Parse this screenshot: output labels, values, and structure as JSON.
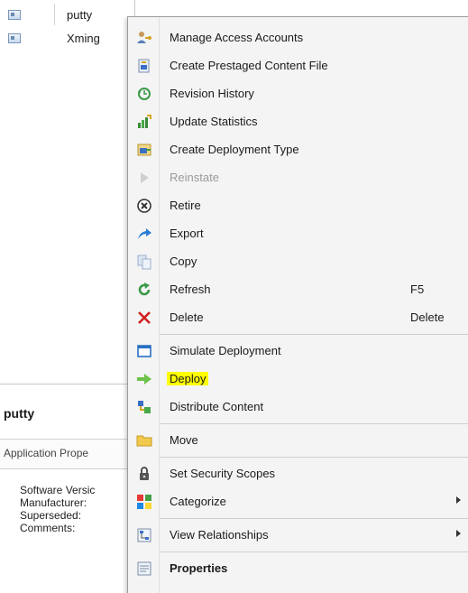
{
  "list": {
    "rows": [
      {
        "name": "putty"
      },
      {
        "name": "Xming"
      }
    ]
  },
  "details": {
    "title": "putty",
    "section_label": "Application Prope",
    "properties": [
      "Software Versic",
      "Manufacturer:",
      "Superseded:",
      "Comments:"
    ]
  },
  "menu": {
    "items": [
      {
        "label": "Manage Access Accounts",
        "icon": "user-key-icon"
      },
      {
        "label": "Create Prestaged Content File",
        "icon": "prestaged-file-icon"
      },
      {
        "label": "Revision History",
        "icon": "history-icon"
      },
      {
        "label": "Update Statistics",
        "icon": "statistics-icon"
      },
      {
        "label": "Create Deployment Type",
        "icon": "deployment-type-icon"
      },
      {
        "label": "Reinstate",
        "icon": "play-icon",
        "disabled": true
      },
      {
        "label": "Retire",
        "icon": "retire-icon"
      },
      {
        "label": "Export",
        "icon": "export-arrow-icon"
      },
      {
        "label": "Copy",
        "icon": "copy-icon"
      },
      {
        "label": "Refresh",
        "icon": "refresh-icon",
        "accelerator": "F5"
      },
      {
        "label": "Delete",
        "icon": "delete-x-icon",
        "accelerator": "Delete"
      },
      {
        "label": "Simulate Deployment",
        "icon": "window-icon"
      },
      {
        "label": "Deploy",
        "icon": "deploy-arrow-icon",
        "highlighted": true,
        "highlight_color": "#ffff00"
      },
      {
        "label": "Distribute Content",
        "icon": "distribute-icon"
      },
      {
        "label": "Move",
        "icon": "folder-icon"
      },
      {
        "label": "Set Security Scopes",
        "icon": "lock-icon"
      },
      {
        "label": "Categorize",
        "icon": "categorize-icon",
        "submenu": true
      },
      {
        "label": "View Relationships",
        "icon": "relationships-icon",
        "submenu": true
      },
      {
        "label": "Properties",
        "icon": "properties-icon",
        "bold": true
      }
    ]
  },
  "colors": {
    "menu_background": "#f4f4f4",
    "highlight": "#ffff00",
    "delete_red": "#d02020",
    "deploy_green": "#6cc24a"
  }
}
